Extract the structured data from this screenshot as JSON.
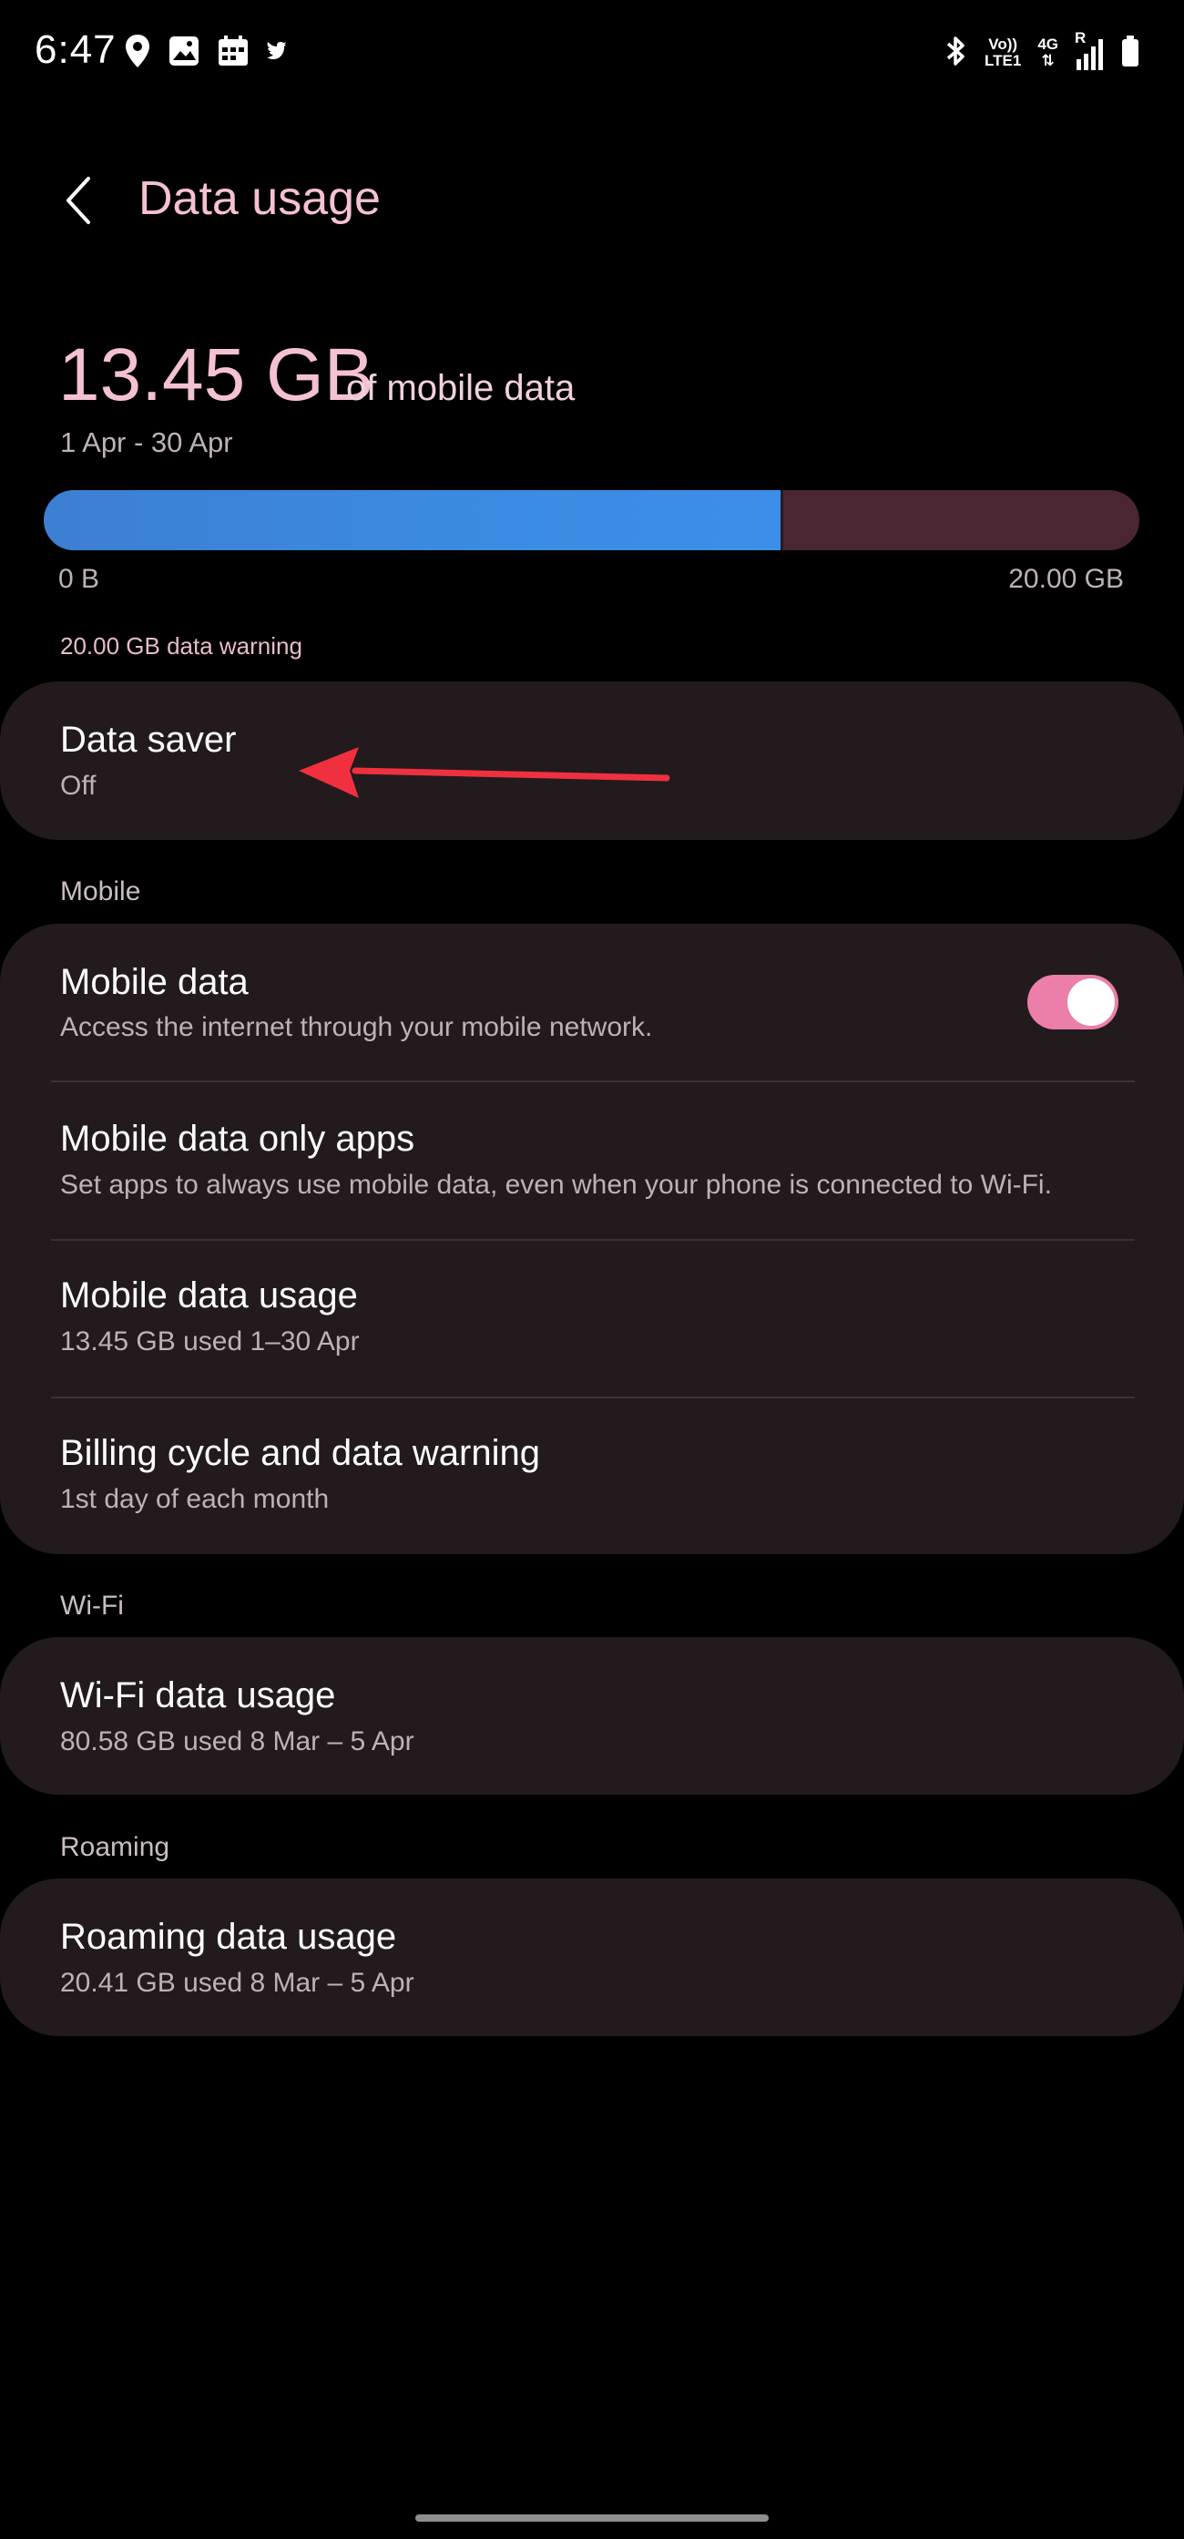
{
  "status_bar": {
    "time": "6:47",
    "left_icons": [
      "location-icon",
      "gallery-icon",
      "calendar-icon",
      "twitter-icon"
    ],
    "network_vo": "Vo))",
    "network_lte": "LTE1",
    "network_type": "4G",
    "roaming": "R",
    "right_icons": [
      "bluetooth-icon",
      "signal-icon",
      "battery-icon"
    ]
  },
  "header": {
    "title": "Data usage"
  },
  "summary": {
    "used": "13.45 GB",
    "suffix": "of mobile data",
    "period": "1 Apr - 30 Apr",
    "bar_min": "0 B",
    "bar_max": "20.00 GB",
    "fill_percent": 67.25,
    "warning": "20.00 GB data warning"
  },
  "data_saver": {
    "title": "Data saver",
    "status": "Off"
  },
  "mobile_section": {
    "label": "Mobile",
    "items": [
      {
        "title": "Mobile data",
        "subtitle": "Access the internet through your mobile network.",
        "toggle_on": true
      },
      {
        "title": "Mobile data only apps",
        "subtitle": "Set apps to always use mobile data, even when your phone is connected to Wi-Fi."
      },
      {
        "title": "Mobile data usage",
        "subtitle": "13.45 GB used 1–30 Apr"
      },
      {
        "title": "Billing cycle and data warning",
        "subtitle": "1st day of each month"
      }
    ]
  },
  "wifi_section": {
    "label": "Wi-Fi",
    "items": [
      {
        "title": "Wi-Fi data usage",
        "subtitle": "80.58 GB used 8 Mar – 5 Apr"
      }
    ]
  },
  "roaming_section": {
    "label": "Roaming",
    "items": [
      {
        "title": "Roaming data usage",
        "subtitle": "20.41 GB used 8 Mar – 5 Apr"
      }
    ]
  },
  "colors": {
    "background": "#000000",
    "accent_pink": "#f4c1d2",
    "bar_used": "#3d8ee8",
    "bar_remaining": "#4a2632",
    "card": "#221a1d",
    "toggle_on": "#eb7fa9",
    "annotation": "#f0303f"
  }
}
